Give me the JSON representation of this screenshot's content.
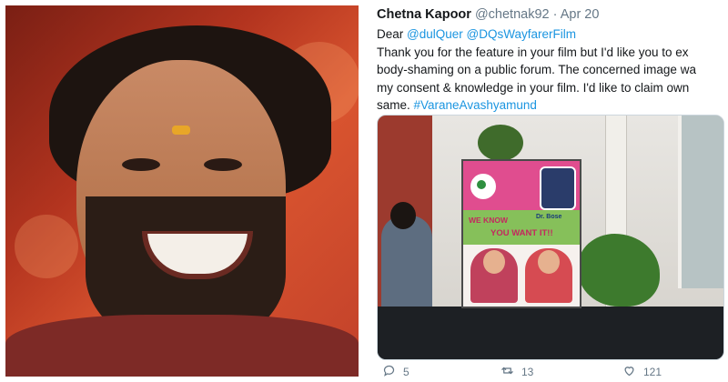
{
  "tweet": {
    "author_name": "Chetna Kapoor",
    "author_handle": "@chetnak92",
    "separator": "·",
    "date": "Apr 20",
    "body": {
      "line1_prefix": "Dear ",
      "mention1": "@dulQuer",
      "space": " ",
      "mention2": "@DQsWayfarerFilm",
      "line2": "Thank you for the feature in your film but I'd like you to ex",
      "line3": "body-shaming on a public forum. The concerned image wa",
      "line4": "my consent & knowledge in your film. I'd like to claim own",
      "line5_prefix": "same. ",
      "hashtag": "#VaraneAvashyamund"
    },
    "media": {
      "poster_slogan_1": "WE KNOW",
      "poster_slogan_2": "YOU WANT IT!!",
      "poster_doctor_label": "Dr. Bose"
    },
    "actions": {
      "replies": "5",
      "retweets": "13",
      "likes": "121"
    }
  },
  "icons": {
    "reply": "reply-icon",
    "retweet": "retweet-icon",
    "like": "heart-icon"
  },
  "colors": {
    "link": "#1b95e0",
    "muted": "#657786",
    "text": "#14171a"
  }
}
